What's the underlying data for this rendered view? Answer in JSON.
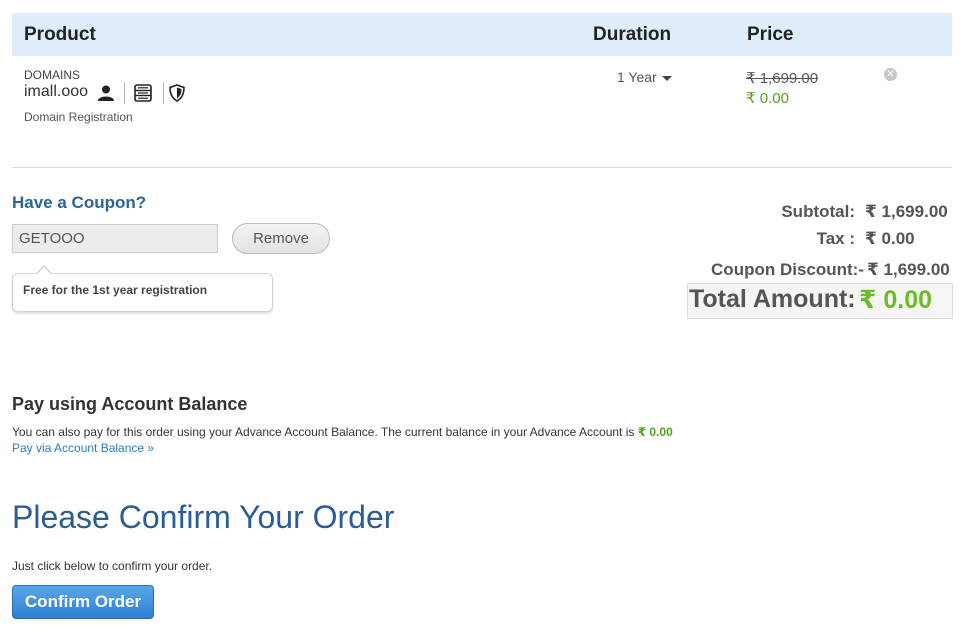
{
  "cart": {
    "headers": {
      "product": "Product",
      "duration": "Duration",
      "price": "Price"
    },
    "item": {
      "category": "DOMAINS",
      "name": "imall.ooo",
      "type": "Domain Registration",
      "duration": "1 Year",
      "price_original": "₹ 1,699.00",
      "price_current": "₹ 0.00",
      "addon_icons": [
        "contact-privacy-icon",
        "dns-server-icon",
        "shield-security-icon"
      ]
    }
  },
  "coupon": {
    "title": "Have a Coupon?",
    "code": "GETOOO",
    "remove_label": "Remove",
    "message": "Free for the 1st year registration"
  },
  "totals": {
    "subtotal_label": "Subtotal:",
    "subtotal_value": "₹ 1,699.00",
    "tax_label": "Tax  :",
    "tax_value": "₹ 0.00",
    "discount_label": "Coupon Discount:-",
    "discount_value": "₹ 1,699.00",
    "total_label": "Total Amount:",
    "total_value": "₹ 0.00"
  },
  "account_balance": {
    "title": "Pay using Account Balance",
    "description": "You can also pay for this order using your Advance Account Balance. The current balance in your Advance Account is",
    "balance": "₹ 0.00",
    "link": "Pay via Account Balance »"
  },
  "confirm": {
    "title": "Please Confirm Your Order",
    "description": "Just click below to confirm your order.",
    "button": "Confirm Order"
  },
  "colors": {
    "header_bg": "#deedf9",
    "link_blue": "#2a6496",
    "price_green": "#52a11b",
    "total_green": "#6abd2a",
    "button_blue": "#2f7fd3"
  }
}
